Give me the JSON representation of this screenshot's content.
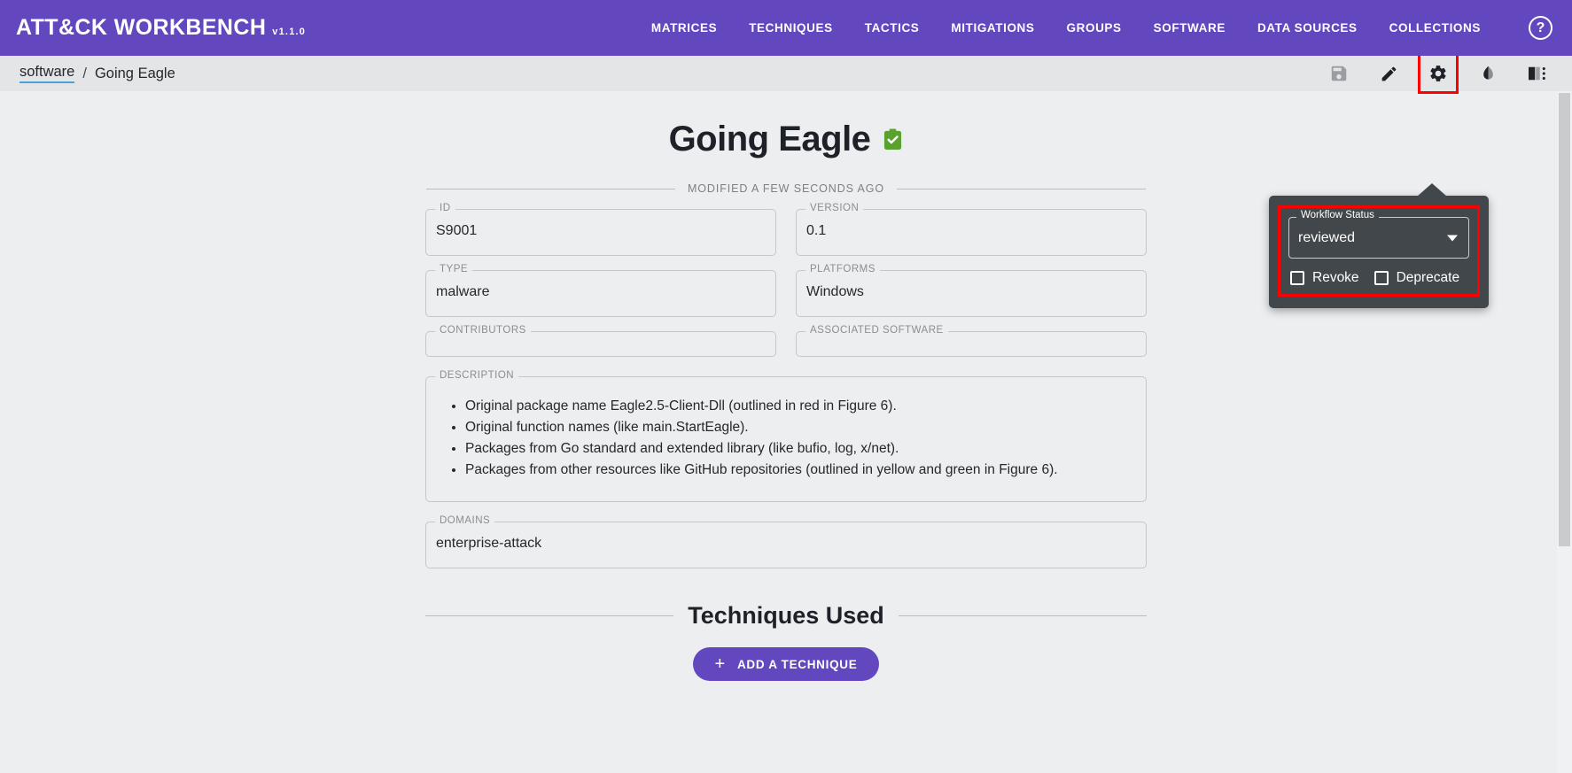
{
  "appbar": {
    "brand": "ATT&CK WORKBENCH",
    "version": "v1.1.0",
    "nav": [
      {
        "label": "MATRICES",
        "name": "nav-matrices"
      },
      {
        "label": "TECHNIQUES",
        "name": "nav-techniques"
      },
      {
        "label": "TACTICS",
        "name": "nav-tactics"
      },
      {
        "label": "MITIGATIONS",
        "name": "nav-mitigations"
      },
      {
        "label": "GROUPS",
        "name": "nav-groups"
      },
      {
        "label": "SOFTWARE",
        "name": "nav-software"
      },
      {
        "label": "DATA SOURCES",
        "name": "nav-data-sources"
      },
      {
        "label": "COLLECTIONS",
        "name": "nav-collections"
      }
    ],
    "help_glyph": "?"
  },
  "breadcrumb": {
    "parent": "software",
    "separator": "/",
    "current": "Going Eagle"
  },
  "toolbar": {
    "save": "save-icon",
    "edit": "pencil-icon",
    "settings": "gear-icon",
    "theme": "contrast-icon",
    "view": "layout-icon"
  },
  "workflow_popup": {
    "legend": "Workflow Status",
    "status_value": "reviewed",
    "revoke_label": "Revoke",
    "deprecate_label": "Deprecate",
    "highlight_color": "#ff0000",
    "panel_color": "#42474b"
  },
  "main": {
    "title": "Going Eagle",
    "status_badge": "clipboard-check-icon",
    "badge_color": "#5ba12f",
    "modified": "MODIFIED A FEW SECONDS AGO",
    "fields": {
      "id": {
        "label": "ID",
        "value": "S9001"
      },
      "version": {
        "label": "VERSION",
        "value": "0.1"
      },
      "type": {
        "label": "TYPE",
        "value": "malware"
      },
      "platforms": {
        "label": "PLATFORMS",
        "value": "Windows"
      },
      "contributors": {
        "label": "CONTRIBUTORS",
        "value": ""
      },
      "associated_software": {
        "label": "ASSOCIATED SOFTWARE",
        "value": ""
      },
      "description": {
        "label": "DESCRIPTION"
      },
      "domains": {
        "label": "DOMAINS",
        "value": "enterprise-attack"
      }
    },
    "description_items": [
      "Original package name Eagle2.5-Client-Dll (outlined in red in Figure 6).",
      "Original function names (like main.StartEagle).",
      "Packages from Go standard and extended library (like bufio, log, x/net).",
      "Packages from other resources like GitHub repositories (outlined in yellow and green in Figure 6)."
    ],
    "techniques_section": {
      "title": "Techniques Used",
      "add_button": "ADD A TECHNIQUE",
      "plus_glyph": "+"
    }
  },
  "theme": {
    "accent": "#6247bf",
    "page_bg": "#eceef0",
    "crumbbar_bg": "#e4e5e7"
  }
}
